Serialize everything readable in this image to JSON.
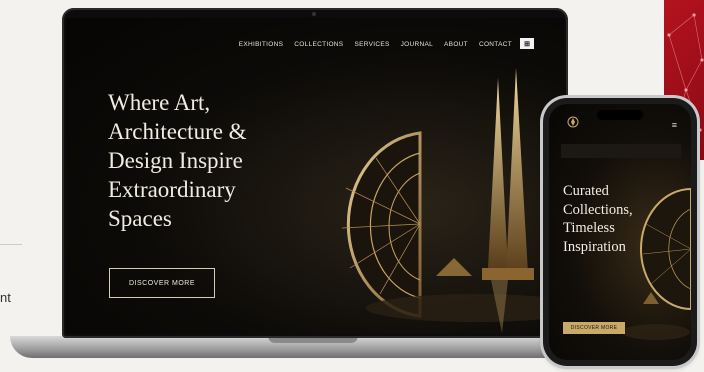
{
  "background": {
    "partial_text": "nt"
  },
  "laptop": {
    "nav": {
      "items": [
        "EXHIBITIONS",
        "COLLECTIONS",
        "SERVICES",
        "JOURNAL",
        "ABOUT",
        "CONTACT"
      ],
      "logo": "⊞"
    },
    "hero": {
      "title_lines": [
        "Where Art,",
        "Architecture &",
        "Design Inspire",
        "Extraordinary",
        "Spaces"
      ],
      "cta_label": "DISCOVER MORE"
    }
  },
  "phone": {
    "menu_icon": "≡",
    "hero": {
      "title_lines": [
        "Curated",
        "Collections,",
        "Timeless",
        "Inspiration"
      ],
      "cta_label": "DISCOVER MORE"
    }
  },
  "colors": {
    "accent_gold": "#c8a96a",
    "screen_dark": "#0d0b08",
    "brand_red": "#b4121e"
  }
}
